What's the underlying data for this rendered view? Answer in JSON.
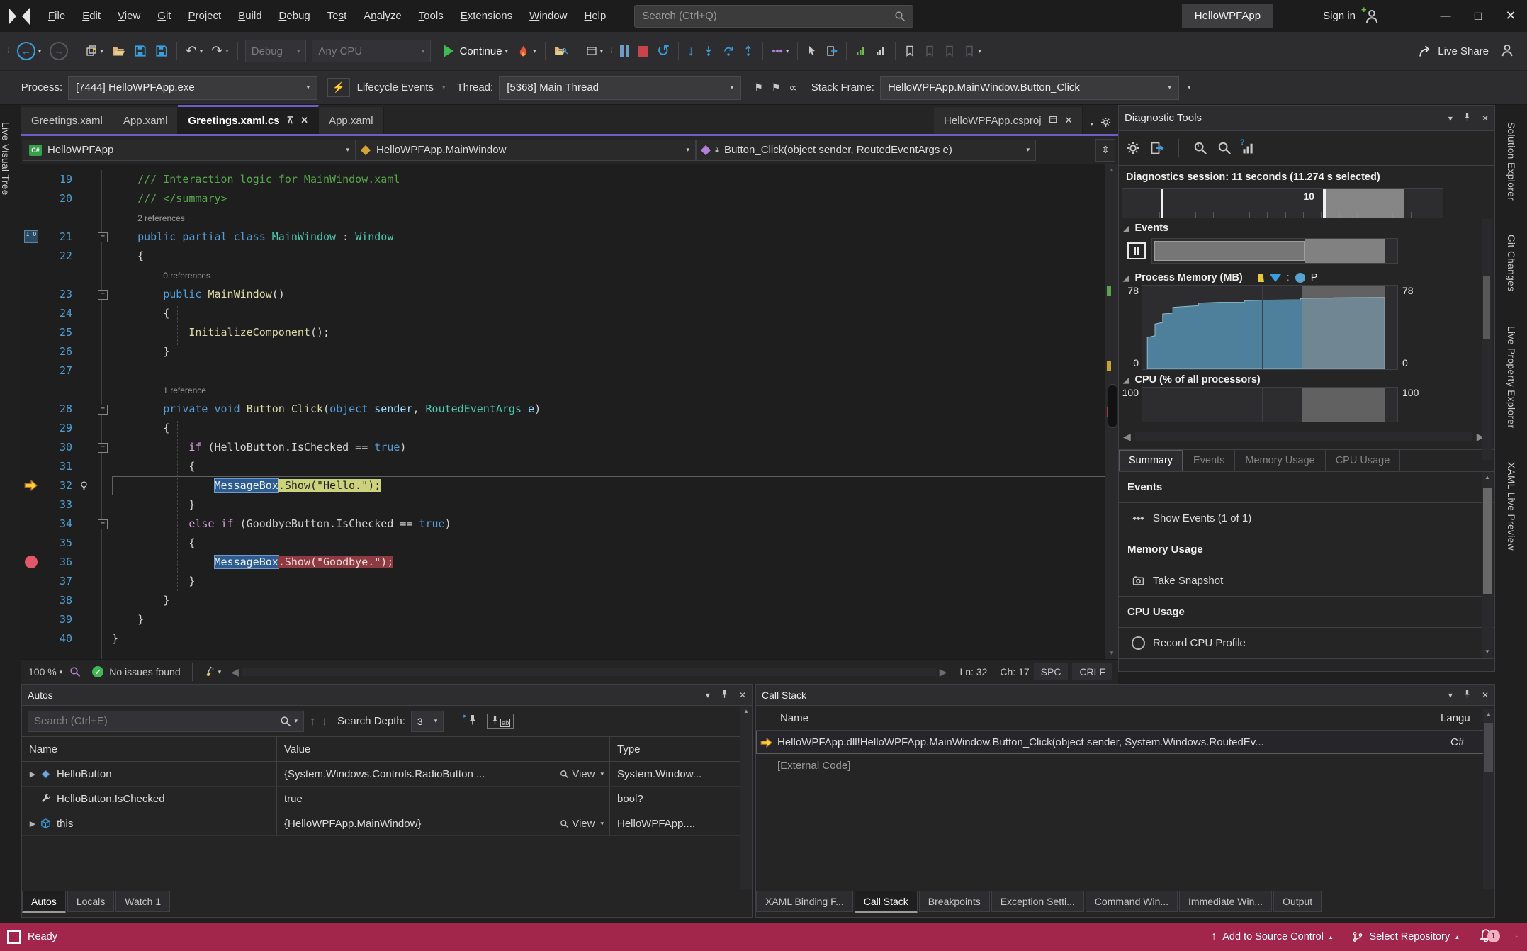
{
  "window": {
    "menu": [
      {
        "label": "File",
        "u": 0
      },
      {
        "label": "Edit",
        "u": 0
      },
      {
        "label": "View",
        "u": 0
      },
      {
        "label": "Git",
        "u": 0
      },
      {
        "label": "Project",
        "u": 0
      },
      {
        "label": "Build",
        "u": 0
      },
      {
        "label": "Debug",
        "u": 0
      },
      {
        "label": "Test",
        "u": 2
      },
      {
        "label": "Analyze",
        "u": 1
      },
      {
        "label": "Tools",
        "u": 0
      },
      {
        "label": "Extensions",
        "u": 0
      },
      {
        "label": "Window",
        "u": 0
      },
      {
        "label": "Help",
        "u": 0
      }
    ],
    "search_placeholder": "Search (Ctrl+Q)",
    "solution_name": "HelloWPFApp",
    "sign_in": "Sign in"
  },
  "toolbar": {
    "configuration": "Debug",
    "platform": "Any CPU",
    "continue": {
      "label": "Continue",
      "u": 0
    },
    "live_share": "Live Share"
  },
  "process_bar": {
    "process_label": "Process:",
    "process_value": "[7444] HelloWPFApp.exe",
    "lifecycle_label": "Lifecycle Events",
    "thread_label": "Thread:",
    "thread_value": "[5368] Main Thread",
    "stack_frame_label": "Stack Frame:",
    "stack_frame_value": "HelloWPFApp.MainWindow.Button_Click"
  },
  "side_tabs": {
    "left": [
      "Live Visual Tree"
    ],
    "right": [
      "Solution Explorer",
      "Git Changes",
      "Live Property Explorer",
      "XAML Live Preview"
    ]
  },
  "editor": {
    "tabs": [
      {
        "label": "Greetings.xaml",
        "active": false
      },
      {
        "label": "App.xaml",
        "active": false
      },
      {
        "label": "Greetings.xaml.cs",
        "active": true
      },
      {
        "label": "App.xaml",
        "active": false
      }
    ],
    "right_tab": "HelloWPFApp.csproj",
    "breadcrumbs": [
      "HelloWPFApp",
      "HelloWPFApp.MainWindow",
      "Button_Click(object sender, RoutedEventArgs e)"
    ],
    "lines": [
      {
        "n": "19",
        "seg": [
          {
            "t": "    /// Interaction logic for MainWindow.xaml",
            "s": "c"
          }
        ]
      },
      {
        "n": "20",
        "seg": [
          {
            "t": "    /// </summary>",
            "s": "c"
          }
        ]
      },
      {
        "seg": [
          {
            "t": "    "
          },
          {
            "t": "2 references",
            "s": "lens"
          }
        ]
      },
      {
        "n": "21",
        "fold": 1,
        "g": "io",
        "seg": [
          {
            "t": "    "
          },
          {
            "t": "public",
            "s": "k"
          },
          {
            "t": " "
          },
          {
            "t": "partial",
            "s": "k"
          },
          {
            "t": " "
          },
          {
            "t": "class",
            "s": "k"
          },
          {
            "t": " "
          },
          {
            "t": "MainWindow",
            "s": "t"
          },
          {
            "t": " : "
          },
          {
            "t": "Window",
            "s": "t"
          }
        ]
      },
      {
        "n": "22",
        "seg": [
          {
            "t": "    {"
          }
        ]
      },
      {
        "seg": [
          {
            "t": "        "
          },
          {
            "t": "0 references",
            "s": "lens"
          }
        ]
      },
      {
        "n": "23",
        "fold": 1,
        "seg": [
          {
            "t": "        "
          },
          {
            "t": "public",
            "s": "k"
          },
          {
            "t": " "
          },
          {
            "t": "MainWindow",
            "s": "m"
          },
          {
            "t": "()"
          }
        ]
      },
      {
        "n": "24",
        "seg": [
          {
            "t": "        {"
          }
        ]
      },
      {
        "n": "25",
        "seg": [
          {
            "t": "            "
          },
          {
            "t": "InitializeComponent",
            "s": "m"
          },
          {
            "t": "();"
          }
        ]
      },
      {
        "n": "26",
        "seg": [
          {
            "t": "        }"
          }
        ]
      },
      {
        "n": "27",
        "seg": []
      },
      {
        "seg": [
          {
            "t": "        "
          },
          {
            "t": "1 reference",
            "s": "lens"
          }
        ]
      },
      {
        "n": "28",
        "fold": 1,
        "seg": [
          {
            "t": "        "
          },
          {
            "t": "private",
            "s": "k"
          },
          {
            "t": " "
          },
          {
            "t": "void",
            "s": "k"
          },
          {
            "t": " "
          },
          {
            "t": "Button_Click",
            "s": "m"
          },
          {
            "t": "("
          },
          {
            "t": "object",
            "s": "k"
          },
          {
            "t": " "
          },
          {
            "t": "sender",
            "s": "p"
          },
          {
            "t": ", "
          },
          {
            "t": "RoutedEventArgs",
            "s": "t"
          },
          {
            "t": " "
          },
          {
            "t": "e",
            "s": "p"
          },
          {
            "t": ")"
          }
        ]
      },
      {
        "n": "29",
        "seg": [
          {
            "t": "        {"
          }
        ]
      },
      {
        "n": "30",
        "fold": 1,
        "seg": [
          {
            "t": "            "
          },
          {
            "t": "if",
            "s": "ct"
          },
          {
            "t": " (HelloButton.IsChecked == "
          },
          {
            "t": "true",
            "s": "k"
          },
          {
            "t": ")"
          }
        ]
      },
      {
        "n": "31",
        "seg": [
          {
            "t": "            {"
          }
        ]
      },
      {
        "n": "32",
        "g": "arrow",
        "bulb": 1,
        "cur": 1,
        "seg": [
          {
            "t": "                "
          },
          {
            "t": "MessageBox",
            "b": "bb"
          },
          {
            "t": ".Show(\"Hello.\");",
            "b": "by"
          }
        ]
      },
      {
        "n": "33",
        "seg": [
          {
            "t": "            }"
          }
        ]
      },
      {
        "n": "34",
        "fold": 1,
        "seg": [
          {
            "t": "            "
          },
          {
            "t": "else",
            "s": "ct"
          },
          {
            "t": " "
          },
          {
            "t": "if",
            "s": "ct"
          },
          {
            "t": " (GoodbyeButton.IsChecked == "
          },
          {
            "t": "true",
            "s": "k"
          },
          {
            "t": ")"
          }
        ]
      },
      {
        "n": "35",
        "seg": [
          {
            "t": "            {"
          }
        ]
      },
      {
        "n": "36",
        "g": "bp",
        "seg": [
          {
            "t": "                "
          },
          {
            "t": "MessageBox",
            "b": "bb"
          },
          {
            "t": ".Show(\"Goodbye.\");",
            "b": "br"
          }
        ]
      },
      {
        "n": "37",
        "seg": [
          {
            "t": "            }"
          }
        ]
      },
      {
        "n": "38",
        "seg": [
          {
            "t": "        }"
          }
        ]
      },
      {
        "n": "39",
        "seg": [
          {
            "t": "    }"
          }
        ]
      },
      {
        "n": "40",
        "seg": [
          {
            "t": "}"
          }
        ]
      }
    ],
    "status": {
      "zoom": "100 %",
      "issues": "No issues found",
      "ln": "Ln: 32",
      "ch": "Ch: 17",
      "spc": "SPC",
      "eol": "CRLF"
    }
  },
  "diagnostics": {
    "title": "Diagnostic Tools",
    "session": "Diagnostics session: 11 seconds (11.274 s selected)",
    "ruler_label": "10",
    "events_header": "Events",
    "memory_header": "Process Memory (MB)",
    "cpu_header": "CPU (% of all processors)",
    "memory_max": "78",
    "memory_min": "0",
    "cpu_max": "100",
    "legend_p": "P",
    "tabs": [
      {
        "label": "Summary",
        "active": true
      },
      {
        "label": "Events",
        "active": false
      },
      {
        "label": "Memory Usage",
        "active": false
      },
      {
        "label": "CPU Usage",
        "active": false
      }
    ],
    "summary": [
      {
        "kind": "hdr",
        "label": "Events"
      },
      {
        "kind": "item",
        "icon": "events",
        "label": "Show Events (1 of 1)"
      },
      {
        "kind": "hdr",
        "label": "Memory Usage"
      },
      {
        "kind": "item",
        "icon": "camera",
        "label": "Take Snapshot"
      },
      {
        "kind": "hdr",
        "label": "CPU Usage"
      },
      {
        "kind": "item",
        "icon": "record",
        "label": "Record CPU Profile"
      }
    ],
    "chart_data": {
      "type": "area",
      "title": "Process Memory (MB)",
      "ylim": [
        0,
        78
      ],
      "selection_pct": {
        "start": 62.5,
        "end": 95
      },
      "memory_points_pct": [
        [
          2,
          100
        ],
        [
          2,
          62
        ],
        [
          5,
          60
        ],
        [
          5,
          46
        ],
        [
          8,
          44
        ],
        [
          8,
          34
        ],
        [
          12,
          33
        ],
        [
          12,
          26
        ],
        [
          17,
          25
        ],
        [
          22,
          24
        ],
        [
          22,
          21
        ],
        [
          30,
          20
        ],
        [
          40,
          20
        ],
        [
          40,
          18
        ],
        [
          47,
          17.5
        ],
        [
          62,
          17
        ],
        [
          62,
          15.5
        ],
        [
          75,
          15
        ],
        [
          75,
          14.5
        ],
        [
          95,
          14
        ],
        [
          95,
          100
        ]
      ],
      "cpu_points_pct": []
    },
    "timeline": {
      "selection_start": 62.5,
      "selection_end": 88,
      "marker1": 12,
      "marker2": 62.5
    }
  },
  "autos": {
    "title": "Autos",
    "search_placeholder": "Search (Ctrl+E)",
    "depth_label": "Search Depth:",
    "depth_value": "3",
    "columns": [
      "Name",
      "Value",
      "Type"
    ],
    "view_label": "View",
    "rows": [
      {
        "expand": true,
        "icon": "field",
        "name": "HelloButton",
        "value": "{System.Windows.Controls.RadioButton ...",
        "view": true,
        "type": "System.Window..."
      },
      {
        "expand": false,
        "icon": "wrench",
        "name": "HelloButton.IsChecked",
        "value": "true",
        "view": false,
        "type": "bool?"
      },
      {
        "expand": true,
        "icon": "object",
        "name": "this",
        "value": "{HelloWPFApp.MainWindow}",
        "view": true,
        "type": "HelloWPFApp...."
      }
    ],
    "tabs": [
      {
        "label": "Autos",
        "active": true
      },
      {
        "label": "Locals",
        "active": false
      },
      {
        "label": "Watch 1",
        "active": false
      }
    ]
  },
  "call_stack": {
    "title": "Call Stack",
    "columns": [
      "Name",
      "Langu"
    ],
    "rows": [
      {
        "current": true,
        "name": "HelloWPFApp.dll!HelloWPFApp.MainWindow.Button_Click(object sender, System.Windows.RoutedEv...",
        "lang": "C#"
      },
      {
        "current": false,
        "name": "[External Code]",
        "lang": ""
      }
    ],
    "tabs": [
      {
        "label": "XAML Binding F...",
        "active": false
      },
      {
        "label": "Call Stack",
        "active": true
      },
      {
        "label": "Breakpoints",
        "active": false
      },
      {
        "label": "Exception Setti...",
        "active": false
      },
      {
        "label": "Command Win...",
        "active": false
      },
      {
        "label": "Immediate Win...",
        "active": false
      },
      {
        "label": "Output",
        "active": false
      }
    ]
  },
  "status_bar": {
    "ready": "Ready",
    "add_to_source_control": "Add to Source Control",
    "select_repository": "Select Repository",
    "notification_count": "1"
  },
  "colors": {
    "accent_purple": "#6B5EC7",
    "debug_status_red": "#A2264B",
    "breakpoint_red": "#E1586B",
    "current_statement_yellow": "#CCD17E",
    "memory_area_blue": "#4E7F9B"
  }
}
